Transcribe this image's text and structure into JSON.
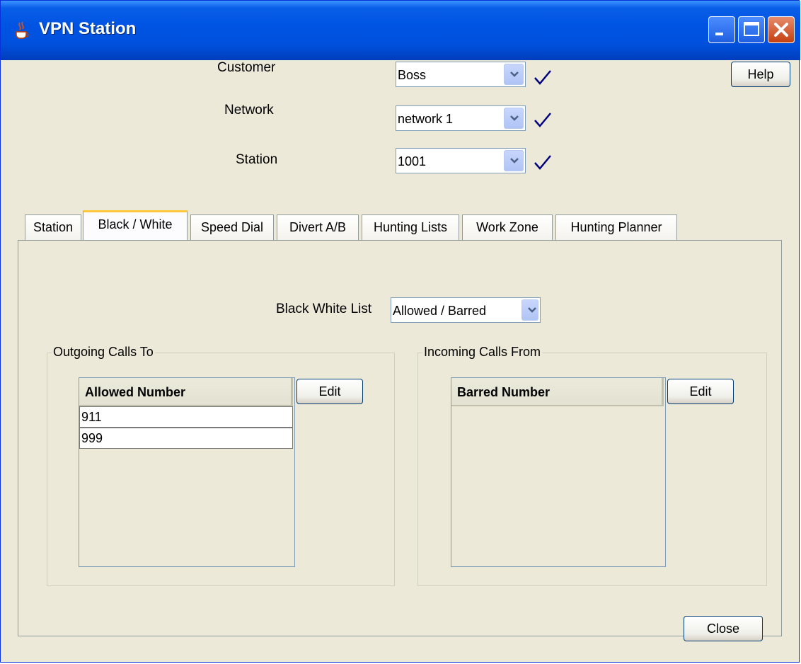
{
  "window": {
    "title": "VPN Station"
  },
  "header": {
    "customer": {
      "label": "Customer",
      "value": "Boss"
    },
    "network": {
      "label": "Network",
      "value": "network 1"
    },
    "station": {
      "label": "Station",
      "value": "1001"
    },
    "help_label": "Help"
  },
  "tabs": [
    {
      "label": "Station"
    },
    {
      "label": "Black / White"
    },
    {
      "label": "Speed Dial"
    },
    {
      "label": "Divert A/B"
    },
    {
      "label": "Hunting Lists"
    },
    {
      "label": "Work Zone"
    },
    {
      "label": "Hunting Planner"
    }
  ],
  "active_tab": "Black / White",
  "black_white": {
    "list_label": "Black White List",
    "list_value": "Allowed / Barred",
    "outgoing": {
      "legend": "Outgoing Calls To",
      "column": "Allowed Number",
      "rows": [
        "911",
        "999"
      ],
      "edit_label": "Edit"
    },
    "incoming": {
      "legend": "Incoming Calls From",
      "column": "Barred Number",
      "rows": [],
      "edit_label": "Edit"
    }
  },
  "footer": {
    "close_label": "Close"
  },
  "colors": {
    "titlebar": "#0054e3",
    "face": "#ece9d8",
    "active_tab_accent": "#ffc83c",
    "check": "#000080"
  },
  "icons": [
    "java-cup-icon",
    "minimize-icon",
    "maximize-icon",
    "close-icon",
    "checkmark-icon",
    "chevron-down-icon"
  ]
}
